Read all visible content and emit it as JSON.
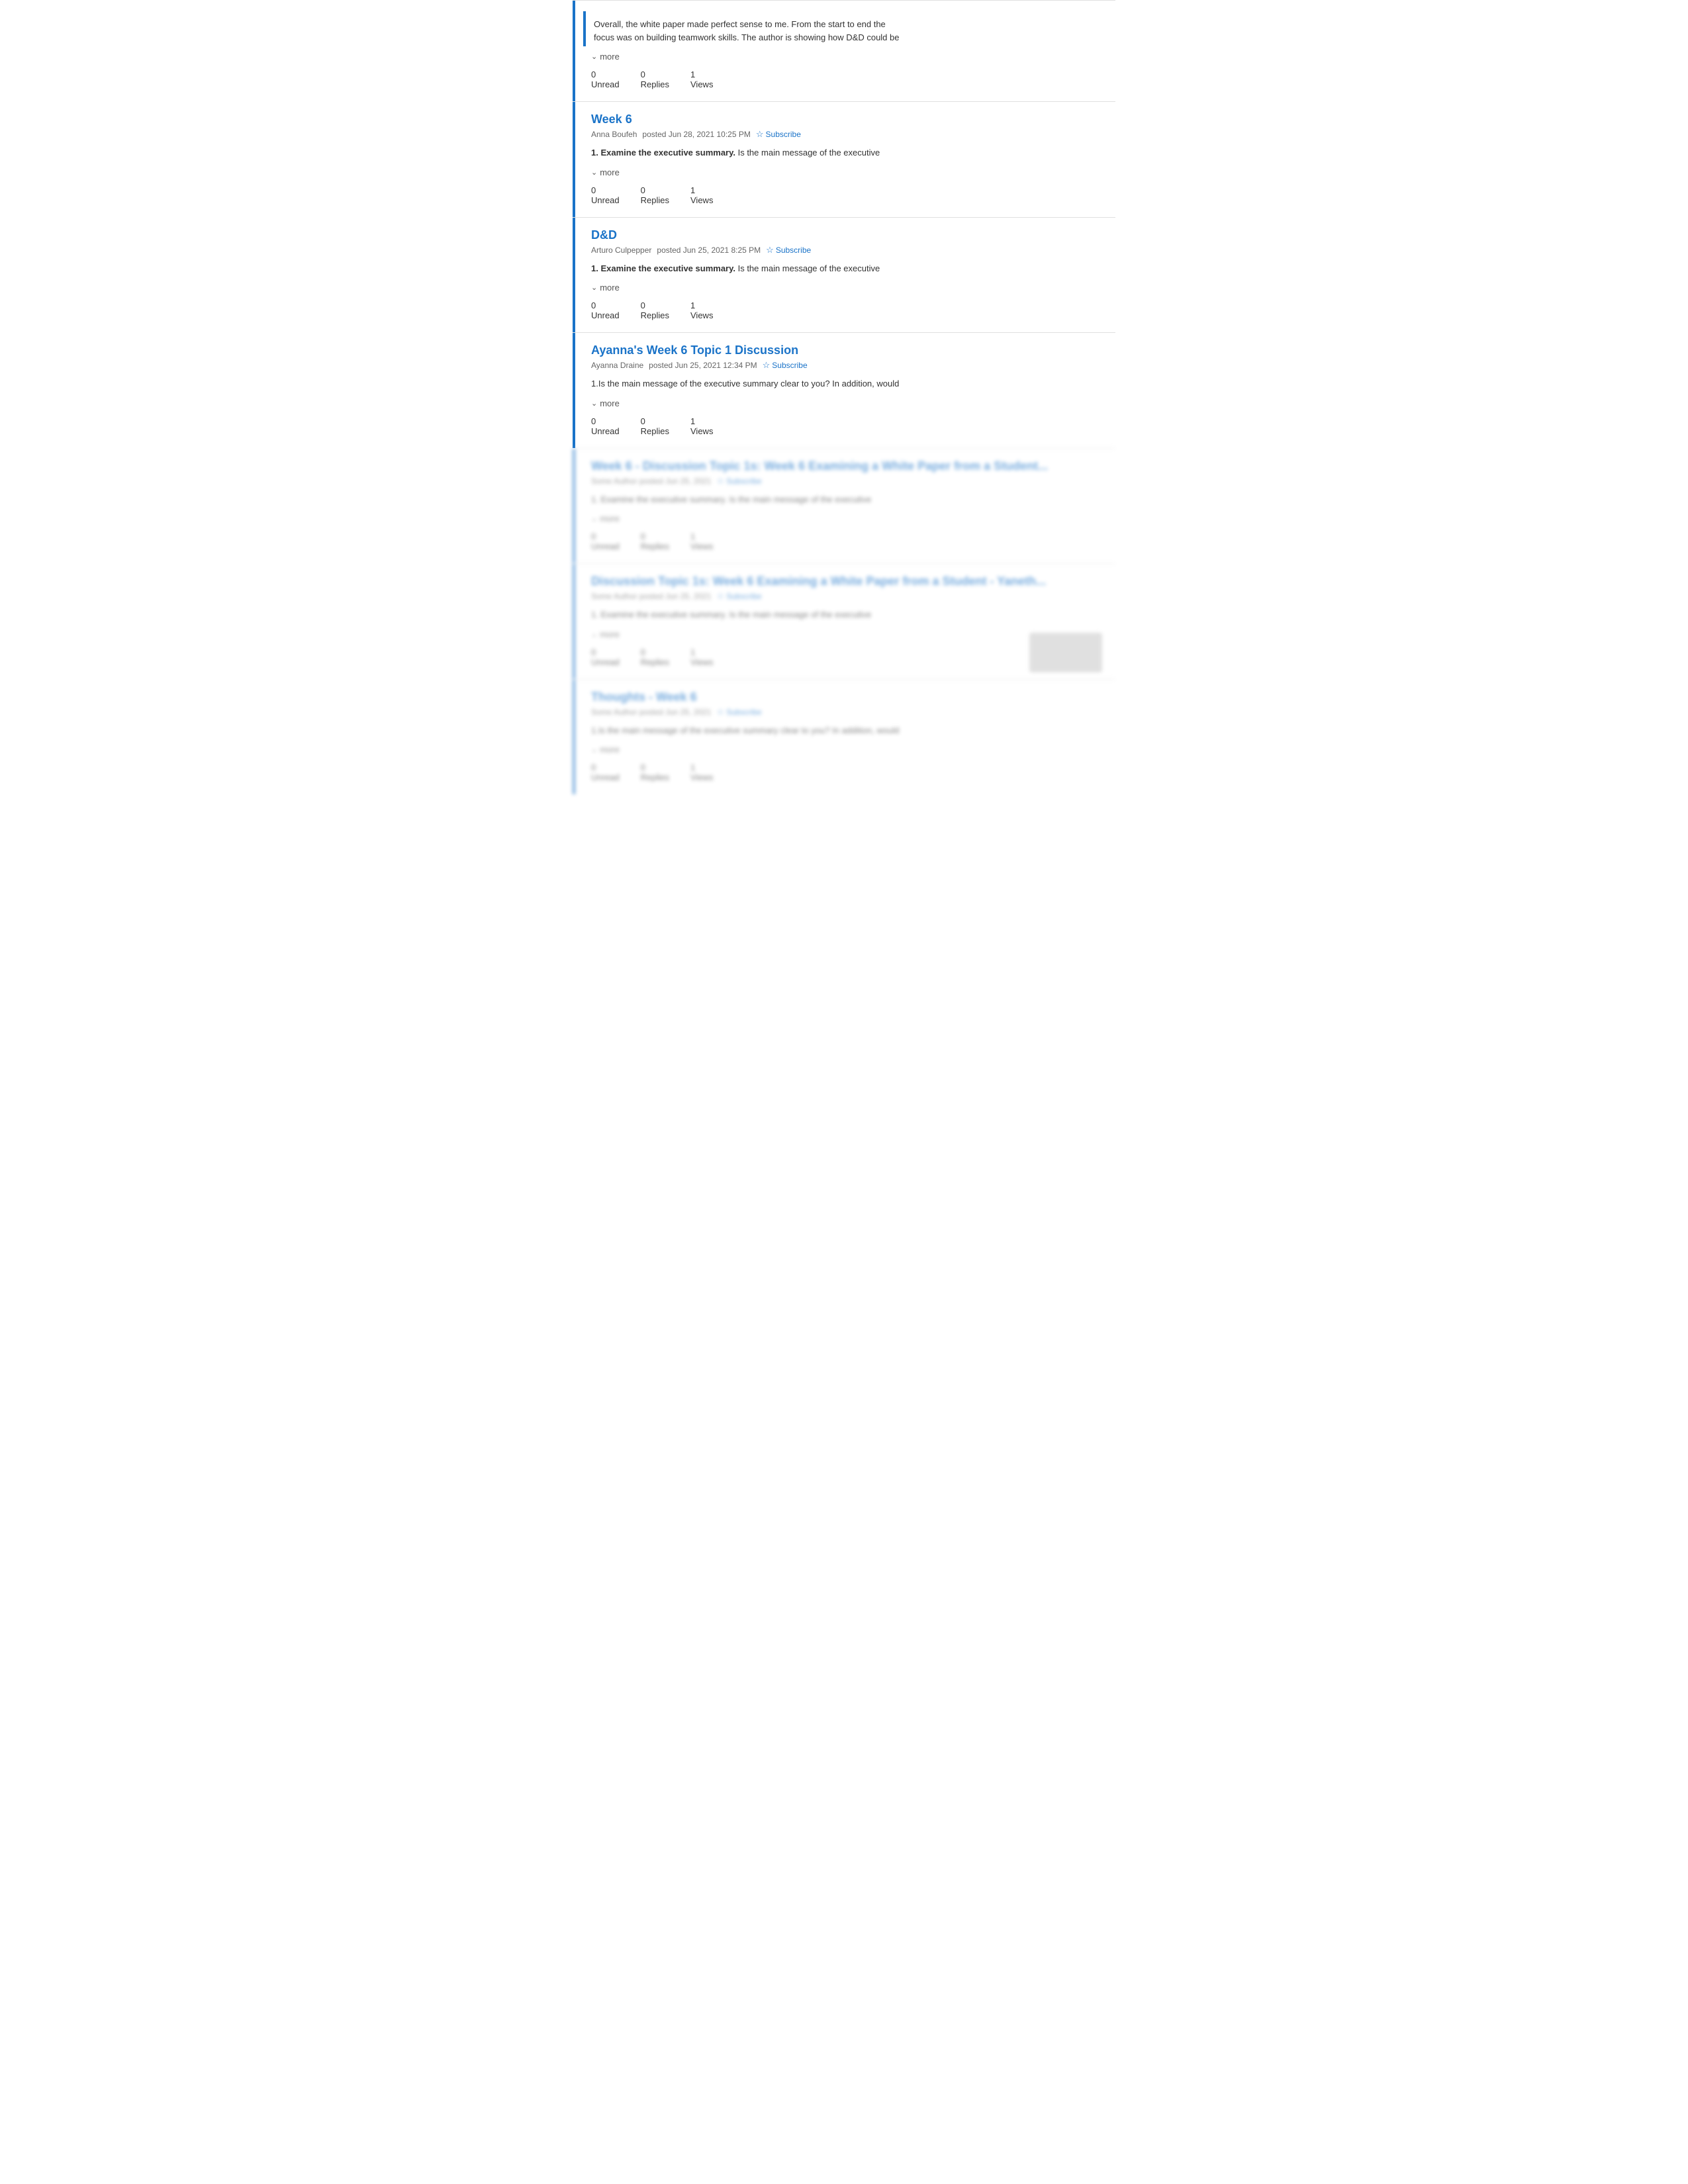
{
  "items": [
    {
      "id": "intro-post",
      "isIntro": true,
      "text": "Overall, the white paper made perfect sense to me. From the start to end the focus was on building teamwork skills. The author is showing how D&D could be",
      "more_label": "more",
      "stats": [
        {
          "number": "0",
          "label": "Unread"
        },
        {
          "number": "0",
          "label": "Replies"
        },
        {
          "number": "1",
          "label": "Views"
        }
      ]
    },
    {
      "id": "week6",
      "title": "Week 6",
      "author": "Anna Boufeh",
      "posted": "posted Jun 28, 2021 10:25 PM",
      "subscribe_label": "Subscribe",
      "content": "1.  Examine the executive summary.   Is the main message of the executive",
      "more_label": "more",
      "stats": [
        {
          "number": "0",
          "label": "Unread"
        },
        {
          "number": "0",
          "label": "Replies"
        },
        {
          "number": "1",
          "label": "Views"
        }
      ]
    },
    {
      "id": "dnd",
      "title": "D&D",
      "author": "Arturo Culpepper",
      "posted": "posted Jun 25, 2021 8:25 PM",
      "subscribe_label": "Subscribe",
      "content": "1. Examine the executive summary.   Is the main message of the executive",
      "more_label": "more",
      "stats": [
        {
          "number": "0",
          "label": "Unread"
        },
        {
          "number": "0",
          "label": "Replies"
        },
        {
          "number": "1",
          "label": "Views"
        }
      ]
    },
    {
      "id": "ayannas-week6",
      "title": "Ayanna's Week 6 Topic 1 Discussion",
      "author": "Ayanna Draine",
      "posted": "posted Jun 25, 2021 12:34 PM",
      "subscribe_label": "Subscribe",
      "content": "1.Is the main message of the executive summary clear to you? In addition, would",
      "more_label": "more",
      "stats": [
        {
          "number": "0",
          "label": "Unread"
        },
        {
          "number": "0",
          "label": "Replies"
        },
        {
          "number": "1",
          "label": "Views"
        }
      ]
    },
    {
      "id": "blurred-1",
      "title": "Week 6 - Discussion Topic 1s: Week 6 Examining a White Paper from a Student...",
      "author": "Some Author posted Jun 25, 2021",
      "subscribe_label": "Subscribe",
      "content": "1. Examine the executive summary. Is the main message of the executive",
      "more_label": "more",
      "blurred": true,
      "stats": [
        {
          "number": "0",
          "label": "Unread"
        },
        {
          "number": "0",
          "label": "Replies"
        },
        {
          "number": "1",
          "label": "Views"
        }
      ]
    },
    {
      "id": "blurred-2",
      "title": "Discussion Topic 1s: Week 6 Examining a White Paper from a Student - Yaneth...",
      "author": "Some Author posted Jun 25, 2021",
      "subscribe_label": "Subscribe",
      "content": "1. Examine the executive summary. Is the main message of the executive",
      "more_label": "more",
      "blurred": true,
      "hasImage": true,
      "stats": [
        {
          "number": "0",
          "label": "Unread"
        },
        {
          "number": "0",
          "label": "Replies"
        },
        {
          "number": "1",
          "label": "Views"
        }
      ]
    },
    {
      "id": "blurred-3",
      "title": "Thoughts - Week 6",
      "author": "Some Author posted Jun 25, 2021",
      "subscribe_label": "Subscribe",
      "content": "1.Is the main message of the executive summary clear to you? In addition, would",
      "more_label": "more",
      "blurred": true,
      "stats": [
        {
          "number": "0",
          "label": "Unread"
        },
        {
          "number": "0",
          "label": "Replies"
        },
        {
          "number": "1",
          "label": "Views"
        }
      ]
    }
  ]
}
